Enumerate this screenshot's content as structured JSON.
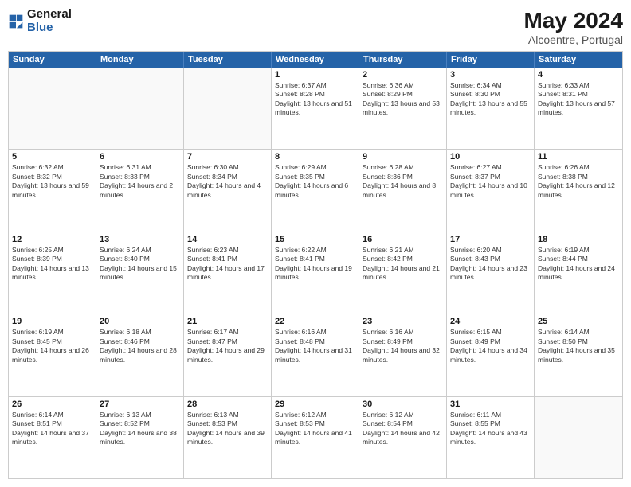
{
  "logo": {
    "text_general": "General",
    "text_blue": "Blue"
  },
  "header": {
    "month_title": "May 2024",
    "location": "Alcoentre, Portugal"
  },
  "weekdays": [
    "Sunday",
    "Monday",
    "Tuesday",
    "Wednesday",
    "Thursday",
    "Friday",
    "Saturday"
  ],
  "rows": [
    [
      {
        "day": "",
        "sunrise": "",
        "sunset": "",
        "daylight": "",
        "empty": true
      },
      {
        "day": "",
        "sunrise": "",
        "sunset": "",
        "daylight": "",
        "empty": true
      },
      {
        "day": "",
        "sunrise": "",
        "sunset": "",
        "daylight": "",
        "empty": true
      },
      {
        "day": "1",
        "sunrise": "Sunrise: 6:37 AM",
        "sunset": "Sunset: 8:28 PM",
        "daylight": "Daylight: 13 hours and 51 minutes.",
        "empty": false
      },
      {
        "day": "2",
        "sunrise": "Sunrise: 6:36 AM",
        "sunset": "Sunset: 8:29 PM",
        "daylight": "Daylight: 13 hours and 53 minutes.",
        "empty": false
      },
      {
        "day": "3",
        "sunrise": "Sunrise: 6:34 AM",
        "sunset": "Sunset: 8:30 PM",
        "daylight": "Daylight: 13 hours and 55 minutes.",
        "empty": false
      },
      {
        "day": "4",
        "sunrise": "Sunrise: 6:33 AM",
        "sunset": "Sunset: 8:31 PM",
        "daylight": "Daylight: 13 hours and 57 minutes.",
        "empty": false
      }
    ],
    [
      {
        "day": "5",
        "sunrise": "Sunrise: 6:32 AM",
        "sunset": "Sunset: 8:32 PM",
        "daylight": "Daylight: 13 hours and 59 minutes.",
        "empty": false
      },
      {
        "day": "6",
        "sunrise": "Sunrise: 6:31 AM",
        "sunset": "Sunset: 8:33 PM",
        "daylight": "Daylight: 14 hours and 2 minutes.",
        "empty": false
      },
      {
        "day": "7",
        "sunrise": "Sunrise: 6:30 AM",
        "sunset": "Sunset: 8:34 PM",
        "daylight": "Daylight: 14 hours and 4 minutes.",
        "empty": false
      },
      {
        "day": "8",
        "sunrise": "Sunrise: 6:29 AM",
        "sunset": "Sunset: 8:35 PM",
        "daylight": "Daylight: 14 hours and 6 minutes.",
        "empty": false
      },
      {
        "day": "9",
        "sunrise": "Sunrise: 6:28 AM",
        "sunset": "Sunset: 8:36 PM",
        "daylight": "Daylight: 14 hours and 8 minutes.",
        "empty": false
      },
      {
        "day": "10",
        "sunrise": "Sunrise: 6:27 AM",
        "sunset": "Sunset: 8:37 PM",
        "daylight": "Daylight: 14 hours and 10 minutes.",
        "empty": false
      },
      {
        "day": "11",
        "sunrise": "Sunrise: 6:26 AM",
        "sunset": "Sunset: 8:38 PM",
        "daylight": "Daylight: 14 hours and 12 minutes.",
        "empty": false
      }
    ],
    [
      {
        "day": "12",
        "sunrise": "Sunrise: 6:25 AM",
        "sunset": "Sunset: 8:39 PM",
        "daylight": "Daylight: 14 hours and 13 minutes.",
        "empty": false
      },
      {
        "day": "13",
        "sunrise": "Sunrise: 6:24 AM",
        "sunset": "Sunset: 8:40 PM",
        "daylight": "Daylight: 14 hours and 15 minutes.",
        "empty": false
      },
      {
        "day": "14",
        "sunrise": "Sunrise: 6:23 AM",
        "sunset": "Sunset: 8:41 PM",
        "daylight": "Daylight: 14 hours and 17 minutes.",
        "empty": false
      },
      {
        "day": "15",
        "sunrise": "Sunrise: 6:22 AM",
        "sunset": "Sunset: 8:41 PM",
        "daylight": "Daylight: 14 hours and 19 minutes.",
        "empty": false
      },
      {
        "day": "16",
        "sunrise": "Sunrise: 6:21 AM",
        "sunset": "Sunset: 8:42 PM",
        "daylight": "Daylight: 14 hours and 21 minutes.",
        "empty": false
      },
      {
        "day": "17",
        "sunrise": "Sunrise: 6:20 AM",
        "sunset": "Sunset: 8:43 PM",
        "daylight": "Daylight: 14 hours and 23 minutes.",
        "empty": false
      },
      {
        "day": "18",
        "sunrise": "Sunrise: 6:19 AM",
        "sunset": "Sunset: 8:44 PM",
        "daylight": "Daylight: 14 hours and 24 minutes.",
        "empty": false
      }
    ],
    [
      {
        "day": "19",
        "sunrise": "Sunrise: 6:19 AM",
        "sunset": "Sunset: 8:45 PM",
        "daylight": "Daylight: 14 hours and 26 minutes.",
        "empty": false
      },
      {
        "day": "20",
        "sunrise": "Sunrise: 6:18 AM",
        "sunset": "Sunset: 8:46 PM",
        "daylight": "Daylight: 14 hours and 28 minutes.",
        "empty": false
      },
      {
        "day": "21",
        "sunrise": "Sunrise: 6:17 AM",
        "sunset": "Sunset: 8:47 PM",
        "daylight": "Daylight: 14 hours and 29 minutes.",
        "empty": false
      },
      {
        "day": "22",
        "sunrise": "Sunrise: 6:16 AM",
        "sunset": "Sunset: 8:48 PM",
        "daylight": "Daylight: 14 hours and 31 minutes.",
        "empty": false
      },
      {
        "day": "23",
        "sunrise": "Sunrise: 6:16 AM",
        "sunset": "Sunset: 8:49 PM",
        "daylight": "Daylight: 14 hours and 32 minutes.",
        "empty": false
      },
      {
        "day": "24",
        "sunrise": "Sunrise: 6:15 AM",
        "sunset": "Sunset: 8:49 PM",
        "daylight": "Daylight: 14 hours and 34 minutes.",
        "empty": false
      },
      {
        "day": "25",
        "sunrise": "Sunrise: 6:14 AM",
        "sunset": "Sunset: 8:50 PM",
        "daylight": "Daylight: 14 hours and 35 minutes.",
        "empty": false
      }
    ],
    [
      {
        "day": "26",
        "sunrise": "Sunrise: 6:14 AM",
        "sunset": "Sunset: 8:51 PM",
        "daylight": "Daylight: 14 hours and 37 minutes.",
        "empty": false
      },
      {
        "day": "27",
        "sunrise": "Sunrise: 6:13 AM",
        "sunset": "Sunset: 8:52 PM",
        "daylight": "Daylight: 14 hours and 38 minutes.",
        "empty": false
      },
      {
        "day": "28",
        "sunrise": "Sunrise: 6:13 AM",
        "sunset": "Sunset: 8:53 PM",
        "daylight": "Daylight: 14 hours and 39 minutes.",
        "empty": false
      },
      {
        "day": "29",
        "sunrise": "Sunrise: 6:12 AM",
        "sunset": "Sunset: 8:53 PM",
        "daylight": "Daylight: 14 hours and 41 minutes.",
        "empty": false
      },
      {
        "day": "30",
        "sunrise": "Sunrise: 6:12 AM",
        "sunset": "Sunset: 8:54 PM",
        "daylight": "Daylight: 14 hours and 42 minutes.",
        "empty": false
      },
      {
        "day": "31",
        "sunrise": "Sunrise: 6:11 AM",
        "sunset": "Sunset: 8:55 PM",
        "daylight": "Daylight: 14 hours and 43 minutes.",
        "empty": false
      },
      {
        "day": "",
        "sunrise": "",
        "sunset": "",
        "daylight": "",
        "empty": true
      }
    ]
  ]
}
